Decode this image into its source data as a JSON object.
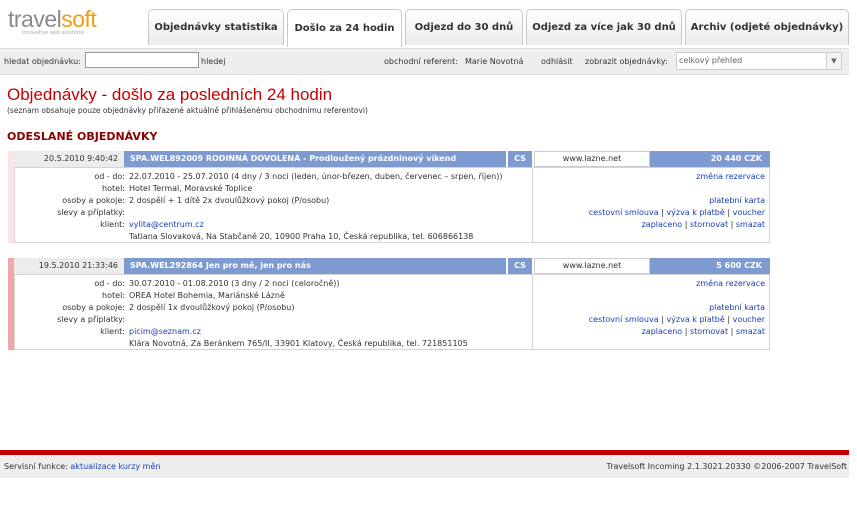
{
  "app": {
    "logo_main": "travel",
    "logo_accent": "soft",
    "logo_tagline": "innovative web solutions"
  },
  "tabs": [
    {
      "label": "Objednávky statistika"
    },
    {
      "label": "Došlo za 24 hodin"
    },
    {
      "label": "Odjezd do 30 dnů"
    },
    {
      "label": "Odjezd za více jak 30 dnů"
    },
    {
      "label": "Archiv (odjeté objednávky)"
    }
  ],
  "search": {
    "label": "hledat objednávku:",
    "value": "",
    "button": "hledej",
    "referent_label": "obchodní referent:",
    "referent_name": "Marie Novotná",
    "logout": "odhlásit",
    "view_label": "zobrazit objednávky:",
    "view_value": "celkový přehled"
  },
  "page": {
    "title": "Objednávky - došlo za posledních 24 hodin",
    "subtitle": "(seznam obsahuje pouze objednávky přiřazené aktuálně přihlášenému obchodnímu referentovi)",
    "section_title": "ODESLANÉ OBJEDNÁVKY"
  },
  "labels": {
    "od_do": "od - do:",
    "hotel": "hotel:",
    "osoby": "osoby a pokoje:",
    "slevy": "slevy a příplatky:",
    "klient": "klient:"
  },
  "orders": [
    {
      "date": "20.5.2010 9:40:42",
      "code": "SPA.WEL892009 RODINNÁ DOVOLENÁ - Prodloužený prázdninový víkend",
      "lang": "CS",
      "web": "www.lazne.net",
      "price": "20 440 CZK",
      "od_do": "22.07.2010 - 25.07.2010 (4 dny / 3 noci (leden, únor-březen, duben, červenec – srpen, říjen))",
      "hotel": "Hotel Termal, Moravské Toplice",
      "osoby": "2 dospělí + 1 dítě 2x dvoulůžkový pokoj (P/osobu)",
      "slevy": "",
      "email": "vylita@centrum.cz",
      "address": "Tatiana Slovaková, Na Stabčaně 20, 10900 Praha 10, Česká republika, tel. 606866138",
      "actions": {
        "change": "změna rezervace",
        "card": "platební karta",
        "contract": "cestovní smlouva",
        "payment": "výzva k platbě",
        "voucher": "voucher",
        "paid": "zaplaceno",
        "cancel": "stornovat",
        "delete": "smazat"
      }
    },
    {
      "date": "19.5.2010 21:33:46",
      "code": "SPA.WEL292864 Jen pro mě, jen pro nás",
      "lang": "CS",
      "web": "www.lazne.net",
      "price": "5 600 CZK",
      "od_do": "30.07.2010 - 01.08.2010 (3 dny / 2 noci (celoročně))",
      "hotel": "OREA Hotel Bohemia, Mariánské Lázně",
      "osoby": "2 dospělí 1x dvoulůžkový pokoj (P/osobu)",
      "slevy": "",
      "email": "picim@seznam.cz",
      "address": "Klára Novotná, Za Beránkem 765/II, 33901 Klatovy, Česká republika, tel. 721851105",
      "actions": {
        "change": "změna rezervace",
        "card": "platební karta",
        "contract": "cestovní smlouva",
        "payment": "výzva k platbě",
        "voucher": "voucher",
        "paid": "zaplaceno",
        "cancel": "stornovat",
        "delete": "smazat"
      }
    }
  ],
  "footer": {
    "label": "Servisní funkce:",
    "link": "aktualizace kurzy měn",
    "version": "Travelsoft Incoming 2.1.3021.20330 ©2006-2007 TravelSoft"
  },
  "colors": {
    "brand_red": "#c40000",
    "dark_red": "#8b0000",
    "header_blue": "#7d9bd1",
    "link_blue": "#1a3fb0",
    "logo_orange": "#f39c12",
    "order1_side": "#fde3e3",
    "order2_side": "#f2a6a6"
  }
}
